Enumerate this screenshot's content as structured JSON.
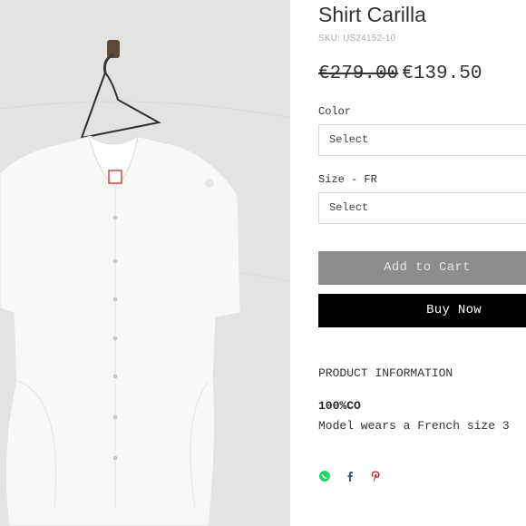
{
  "product": {
    "title": "Shirt Carilla",
    "sku": "SKU: US24152-10",
    "price_original": "€279.00",
    "price_sale": "€139.50"
  },
  "options": {
    "color_label": "Color",
    "color_value": "Select",
    "size_label": "Size - FR",
    "size_value": "Select"
  },
  "actions": {
    "add_to_cart": "Add to Cart",
    "buy_now": "Buy Now"
  },
  "details": {
    "section_title": "PRODUCT INFORMATION",
    "material": "100%CO",
    "model_note": "Model wears a French size 3"
  },
  "share": {
    "icons": [
      "whatsapp-icon",
      "facebook-icon",
      "pinterest-icon"
    ],
    "colors": {
      "whatsapp": "#25D366",
      "facebook": "#3b5998",
      "pinterest": "#cb2027"
    }
  },
  "colors": {
    "add_to_cart_bg": "#8c8c8c",
    "buy_now_bg": "#000000"
  }
}
